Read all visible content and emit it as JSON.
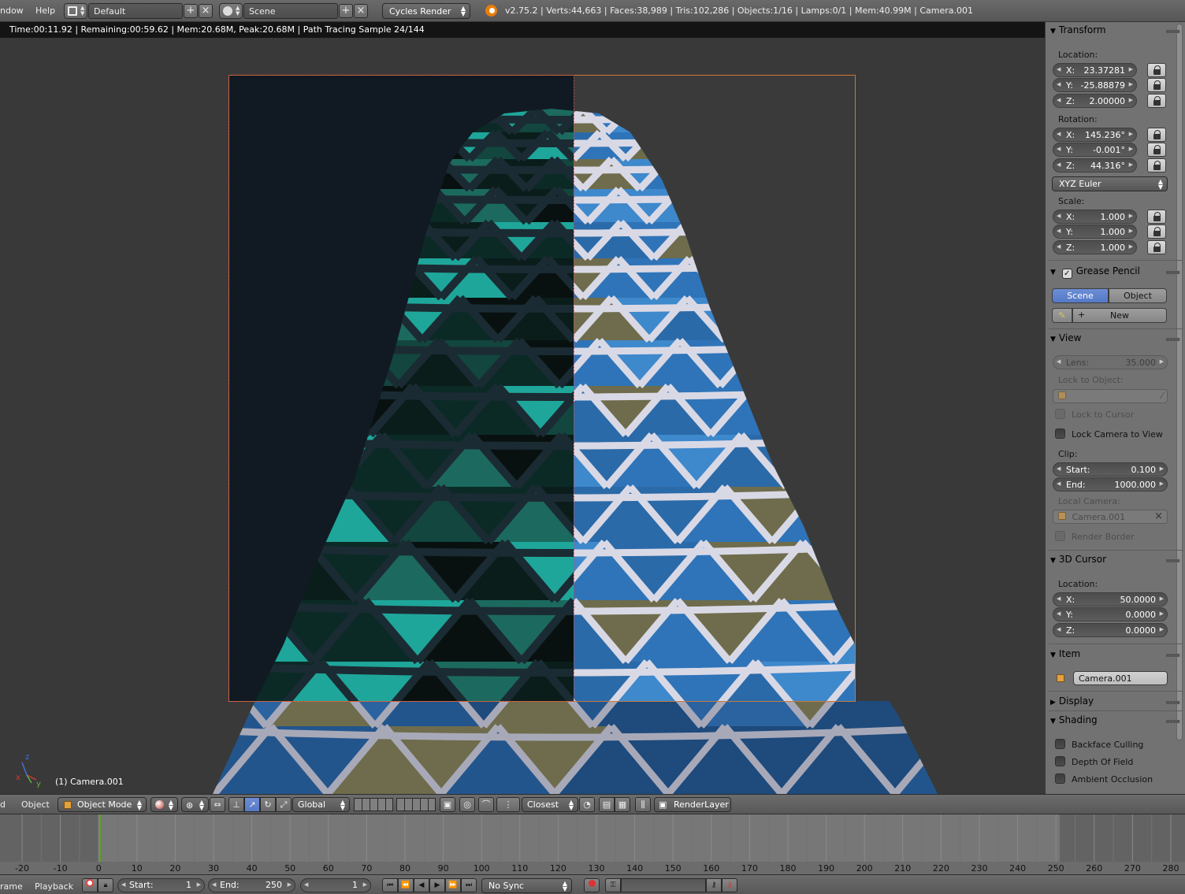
{
  "topbar": {
    "menu_window": "ndow",
    "menu_help": "Help",
    "layout": "Default",
    "scene": "Scene",
    "render_engine": "Cycles Render",
    "stats": "v2.75.2 | Verts:44,663 | Faces:38,989 | Tris:102,286 | Objects:1/16 | Lamps:0/1 | Mem:40.99M | Camera.001"
  },
  "viewport": {
    "render_info": "Time:00:11.92 | Remaining:00:59.62 | Mem:20.68M, Peak:20.68M | Path Tracing Sample 24/144",
    "object_info": "(1) Camera.001",
    "axes": {
      "x": "x",
      "y": "y",
      "z": "z"
    }
  },
  "panel": {
    "transform": {
      "title": "Transform",
      "location_label": "Location:",
      "location": [
        {
          "axis": "X:",
          "value": "23.37281"
        },
        {
          "axis": "Y:",
          "value": "-25.88879"
        },
        {
          "axis": "Z:",
          "value": "2.00000"
        }
      ],
      "rotation_label": "Rotation:",
      "rotation": [
        {
          "axis": "X:",
          "value": "145.236°"
        },
        {
          "axis": "Y:",
          "value": "-0.001°"
        },
        {
          "axis": "Z:",
          "value": "44.316°"
        }
      ],
      "rotation_mode": "XYZ Euler",
      "scale_label": "Scale:",
      "scale": [
        {
          "axis": "X:",
          "value": "1.000"
        },
        {
          "axis": "Y:",
          "value": "1.000"
        },
        {
          "axis": "Z:",
          "value": "1.000"
        }
      ]
    },
    "grease_pencil": {
      "title": "Grease Pencil",
      "tab_scene": "Scene",
      "tab_object": "Object",
      "new_label": "New"
    },
    "view": {
      "title": "View",
      "lens_label": "Lens:",
      "lens_value": "35.000",
      "lock_to_object": "Lock to Object:",
      "lock_to_cursor": "Lock to Cursor",
      "lock_camera_to_view": "Lock Camera to View",
      "clip_label": "Clip:",
      "clip_start_label": "Start:",
      "clip_start": "0.100",
      "clip_end_label": "End:",
      "clip_end": "1000.000",
      "local_camera_label": "Local Camera:",
      "local_camera": "Camera.001",
      "render_border": "Render Border"
    },
    "cursor": {
      "title": "3D Cursor",
      "location_label": "Location:",
      "location": [
        {
          "axis": "X:",
          "value": "50.0000"
        },
        {
          "axis": "Y:",
          "value": "0.0000"
        },
        {
          "axis": "Z:",
          "value": "0.0000"
        }
      ]
    },
    "item": {
      "title": "Item",
      "name": "Camera.001"
    },
    "display": {
      "title": "Display"
    },
    "shading": {
      "title": "Shading",
      "backface_culling": "Backface Culling",
      "depth_of_field": "Depth Of Field",
      "ambient_occlusion": "Ambient Occlusion"
    }
  },
  "toolbar": {
    "menu_view": "d",
    "menu_object": "Object",
    "mode": "Object Mode",
    "orientation": "Global",
    "snap_target": "Closest",
    "render_layer": "RenderLayer"
  },
  "timeline": {
    "current_frame_mark": 1,
    "ruler": [
      "-20",
      "-10",
      "0",
      "10",
      "20",
      "30",
      "40",
      "50",
      "60",
      "70",
      "80",
      "90",
      "100",
      "110",
      "120",
      "130",
      "140",
      "150",
      "160",
      "170",
      "180",
      "190",
      "200",
      "210",
      "220",
      "230",
      "240",
      "250",
      "260",
      "270",
      "280"
    ]
  },
  "playback": {
    "menu_frame": "rame",
    "menu_playback": "Playback",
    "start_label": "Start:",
    "start": "1",
    "end_label": "End:",
    "end": "250",
    "current": "1",
    "sync": "No Sync"
  },
  "colors": {
    "header": "#5f5f5f",
    "panel": "#727272",
    "viewport": "#393939",
    "selection_blue": "#5680c2",
    "render_bg": "#111a23",
    "glass_teal": "#1fa69a",
    "panel_blue": "#2f74b8",
    "panel_olive": "#6e6c4c",
    "frame_white": "#d8d8e4",
    "timeline_marker": "#5aa02c"
  }
}
